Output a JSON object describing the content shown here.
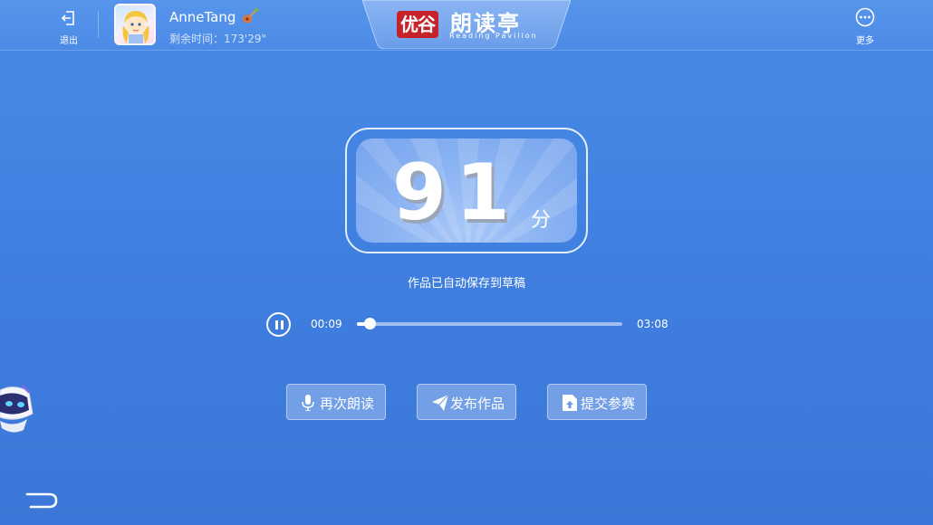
{
  "header": {
    "exit_label": "退出",
    "username": "AnneTang",
    "remaining_time": "剩余时间：173'29\"",
    "more_label": "更多",
    "logo": {
      "brand": "优谷",
      "name": "朗读亭",
      "sub": "Reading Pavilion",
      "brand_color": "#c5222a"
    }
  },
  "score": {
    "value": "91",
    "unit": "分"
  },
  "saved_message": "作品已自动保存到草稿",
  "player": {
    "current_time": "00:09",
    "total_time": "03:08",
    "progress": 0.048,
    "state": "playing"
  },
  "actions": [
    {
      "label": "再次朗读",
      "icon": "microphone-icon"
    },
    {
      "label": "发布作品",
      "icon": "paper-plane-icon"
    },
    {
      "label": "提交参赛",
      "icon": "upload-file-icon"
    }
  ],
  "colors": {
    "background": "#3f7fe0",
    "accent": "#ffffff"
  }
}
